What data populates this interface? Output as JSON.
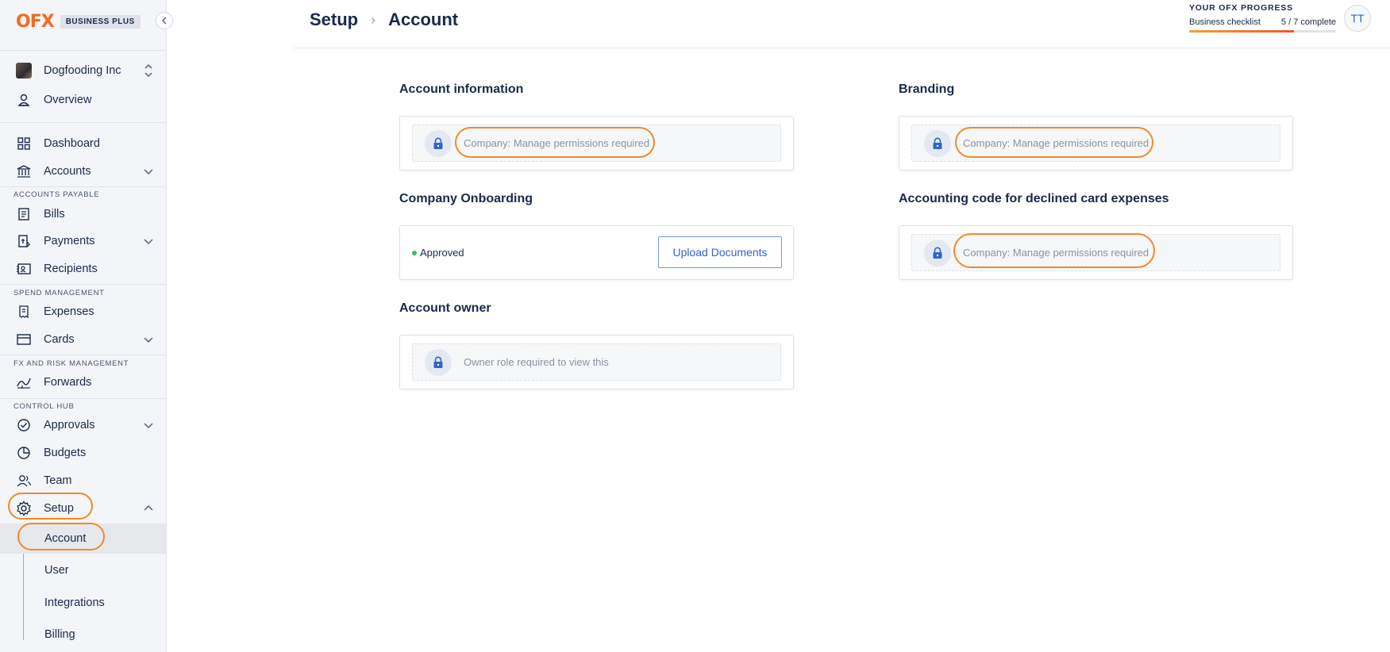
{
  "brand": {
    "logo": "OFX",
    "plan": "BUSINESS PLUS"
  },
  "sidebar": {
    "company": "Dogfooding Inc",
    "items": {
      "overview": "Overview",
      "dashboard": "Dashboard",
      "accounts": "Accounts",
      "bills": "Bills",
      "payments": "Payments",
      "recipients": "Recipients",
      "expenses": "Expenses",
      "cards": "Cards",
      "forwards": "Forwards",
      "approvals": "Approvals",
      "budgets": "Budgets",
      "team": "Team",
      "setup": "Setup"
    },
    "sections": {
      "ap": "ACCOUNTS PAYABLE",
      "spend": "SPEND MANAGEMENT",
      "fx": "FX AND RISK MANAGEMENT",
      "control": "CONTROL HUB"
    },
    "setup_sub": {
      "account": "Account",
      "user": "User",
      "integrations": "Integrations",
      "billing": "Billing"
    }
  },
  "header": {
    "breadcrumb": [
      "Setup",
      "Account"
    ],
    "progress": {
      "title": "YOUR OFX PROGRESS",
      "label": "Business checklist",
      "count": "5 / 7 complete",
      "fraction": 0.714
    },
    "user_initials": "TT"
  },
  "main": {
    "account_info": {
      "title": "Account information",
      "message": "Company: Manage permissions required"
    },
    "branding": {
      "title": "Branding",
      "message": "Company: Manage permissions required"
    },
    "onboarding": {
      "title": "Company Onboarding",
      "status": "Approved",
      "button": "Upload Documents"
    },
    "accounting_code": {
      "title": "Accounting code for declined card expenses",
      "message": "Company: Manage permissions required"
    },
    "account_owner": {
      "title": "Account owner",
      "message": "Owner role required to view this"
    }
  },
  "colors": {
    "brand": "#f26b21",
    "highlight": "#f08a2a",
    "link": "#2f66c9",
    "approved": "#2fbf71",
    "lock": "#2f66c9"
  }
}
